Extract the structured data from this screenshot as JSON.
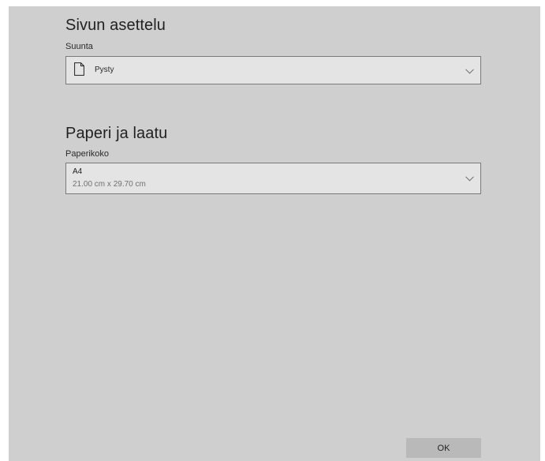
{
  "page_layout": {
    "title": "Sivun asettelu",
    "orientation_label": "Suunta",
    "orientation_value": "Pysty"
  },
  "paper_quality": {
    "title": "Paperi ja laatu",
    "paper_size_label": "Paperikoko",
    "paper_size_value": "A4",
    "paper_size_dimensions": "21.00 cm x 29.70 cm"
  },
  "actions": {
    "ok_label": "OK",
    "close_symbol": "close-icon"
  },
  "colors": {
    "dialog_bg": "#cfcfcf",
    "field_bg": "#e4e4e4",
    "field_border": "#7a7a7a",
    "button_bg": "#b9b9b9"
  }
}
